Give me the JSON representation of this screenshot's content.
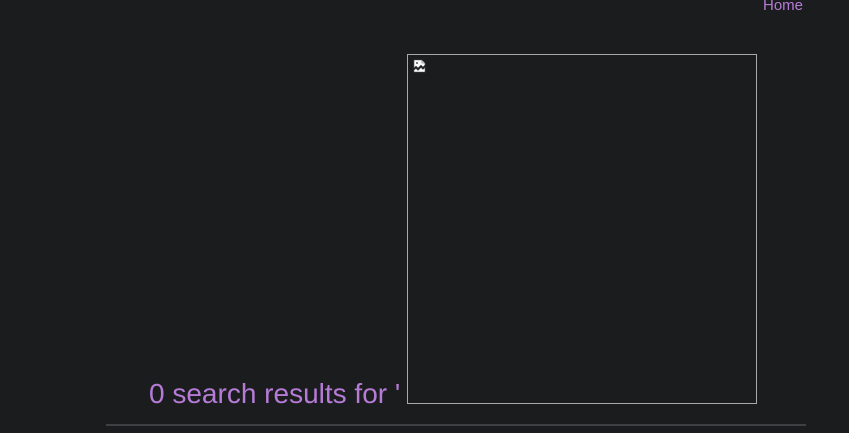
{
  "nav": {
    "home_label": "Home"
  },
  "search": {
    "result_count": "0",
    "results_text": "search results for",
    "quote_open": "'",
    "query": "",
    "quote_close": "'"
  },
  "image": {
    "icon": "broken-image-icon"
  },
  "colors": {
    "background": "#1b1c1e",
    "accent": "#b57bd6",
    "divider": "#3f4043",
    "image_border": "#a8a8a8"
  }
}
